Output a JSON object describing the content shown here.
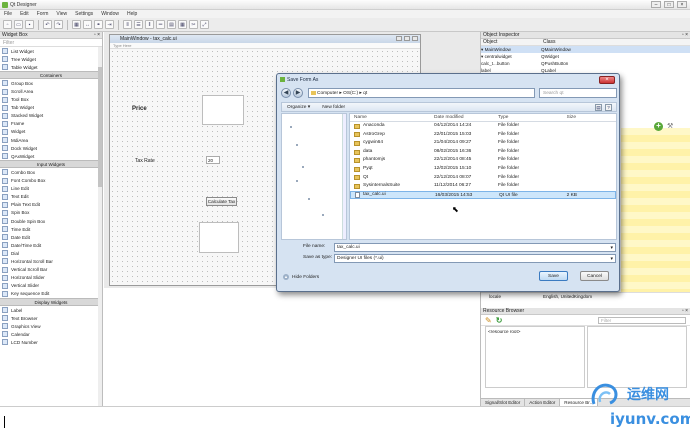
{
  "window": {
    "title": "Qt Designer",
    "controls": [
      "–",
      "□",
      "×"
    ]
  },
  "menubar": [
    "File",
    "Edit",
    "Form",
    "View",
    "Settings",
    "Window",
    "Help"
  ],
  "widget_box": {
    "title": "Widget Box",
    "filter_placeholder": "Filter",
    "items": [
      {
        "kind": "item",
        "label": "List Widget"
      },
      {
        "kind": "item",
        "label": "Tree Widget"
      },
      {
        "kind": "item",
        "label": "Table Widget"
      },
      {
        "kind": "cat",
        "label": "Containers"
      },
      {
        "kind": "item",
        "label": "Group Box"
      },
      {
        "kind": "item",
        "label": "Scroll Area"
      },
      {
        "kind": "item",
        "label": "Tool Box"
      },
      {
        "kind": "item",
        "label": "Tab Widget"
      },
      {
        "kind": "item",
        "label": "Stacked Widget"
      },
      {
        "kind": "item",
        "label": "Frame"
      },
      {
        "kind": "item",
        "label": "Widget"
      },
      {
        "kind": "item",
        "label": "MdiArea"
      },
      {
        "kind": "item",
        "label": "Dock Widget"
      },
      {
        "kind": "item",
        "label": "QAxWidget"
      },
      {
        "kind": "cat",
        "label": "Input Widgets"
      },
      {
        "kind": "item",
        "label": "Combo Box"
      },
      {
        "kind": "item",
        "label": "Font Combo Box"
      },
      {
        "kind": "item",
        "label": "Line Edit"
      },
      {
        "kind": "item",
        "label": "Text Edit"
      },
      {
        "kind": "item",
        "label": "Plain Text Edit"
      },
      {
        "kind": "item",
        "label": "Spin Box"
      },
      {
        "kind": "item",
        "label": "Double Spin Box"
      },
      {
        "kind": "item",
        "label": "Time Edit"
      },
      {
        "kind": "item",
        "label": "Date Edit"
      },
      {
        "kind": "item",
        "label": "Date/Time Edit"
      },
      {
        "kind": "item",
        "label": "Dial"
      },
      {
        "kind": "item",
        "label": "Horizontal Scroll Bar"
      },
      {
        "kind": "item",
        "label": "Vertical Scroll Bar"
      },
      {
        "kind": "item",
        "label": "Horizontal Slider"
      },
      {
        "kind": "item",
        "label": "Vertical Slider"
      },
      {
        "kind": "item",
        "label": "Key sequence Edit"
      },
      {
        "kind": "cat",
        "label": "Display Widgets"
      },
      {
        "kind": "item",
        "label": "Label"
      },
      {
        "kind": "item",
        "label": "Text Browser"
      },
      {
        "kind": "item",
        "label": "Graphics View"
      },
      {
        "kind": "item",
        "label": "Calendar"
      },
      {
        "kind": "item",
        "label": "LCD Number"
      }
    ]
  },
  "form_window": {
    "title": "MainWindow - tax_calc.ui",
    "menu_hint": "Type Here",
    "price_label": "Price",
    "tax_label": "Tax Rate",
    "tax_value": "20",
    "calc_button": "Calculate Tax"
  },
  "object_inspector": {
    "title": "Object Inspector",
    "columns": [
      "Object",
      "Class"
    ],
    "rows": [
      {
        "obj": "▾ MainWindow",
        "cls": "QMainWindow"
      },
      {
        "obj": "  ▾ centralwidget",
        "cls": "QWidget"
      },
      {
        "obj": "     calc_t...button",
        "cls": "QPushButton"
      },
      {
        "obj": "     label",
        "cls": "QLabel"
      }
    ]
  },
  "property_editor": {
    "locale_label": "locale",
    "locale_value": "English, UnitedKingdom"
  },
  "resource_browser": {
    "title": "Resource Browser",
    "filter_placeholder": "Filter",
    "root": "<resource root>",
    "tabs": [
      "Signal/Slot Editor",
      "Action Editor",
      "Resource Br..."
    ]
  },
  "save_dialog": {
    "title": "Save Form As",
    "address": [
      "Computer",
      "OS(C:)",
      "qt"
    ],
    "search_placeholder": "Search qt",
    "organize": "Organize ▾",
    "new_folder": "New folder",
    "columns": [
      "Name",
      "Date modified",
      "Type",
      "Size"
    ],
    "files": [
      {
        "name": "Anaconda",
        "date": "04/12/2014 14:24",
        "type": "File folder",
        "size": "",
        "folder": true
      },
      {
        "name": "AstroGrep",
        "date": "22/01/2015 15:03",
        "type": "File folder",
        "size": "",
        "folder": true
      },
      {
        "name": "cygwin64",
        "date": "21/04/2014 09:27",
        "type": "File folder",
        "size": "",
        "folder": true
      },
      {
        "name": "data",
        "date": "08/02/2015 16:36",
        "type": "File folder",
        "size": "",
        "folder": true
      },
      {
        "name": "phantomjs",
        "date": "22/12/2014 08:45",
        "type": "File folder",
        "size": "",
        "folder": true
      },
      {
        "name": "Pyqt",
        "date": "12/02/2015 15:10",
        "type": "File folder",
        "size": "",
        "folder": true
      },
      {
        "name": "Qt",
        "date": "22/12/2014 08:07",
        "type": "File folder",
        "size": "",
        "folder": true
      },
      {
        "name": "SysinternalsSuite",
        "date": "11/12/2014 06:27",
        "type": "File folder",
        "size": "",
        "folder": true
      },
      {
        "name": "tax_calc.ui",
        "date": "16/03/2015 14:53",
        "type": "Qt UI file",
        "size": "2 KB",
        "folder": false
      }
    ],
    "filename_label": "File name:",
    "filename_value": "tax_calc.ui",
    "saveas_label": "Save as type:",
    "saveas_value": "Designer UI files (*.ui)",
    "hide_folders": "Hide Folders",
    "save_button": "Save",
    "cancel_button": "Cancel"
  },
  "watermark": {
    "line1": "运维网",
    "line2": "iyunv.com"
  },
  "colors": {
    "dialog_bg": "#d6e3f2",
    "accent": "#3a8fe0",
    "property_yellow": "#fff8c8"
  }
}
